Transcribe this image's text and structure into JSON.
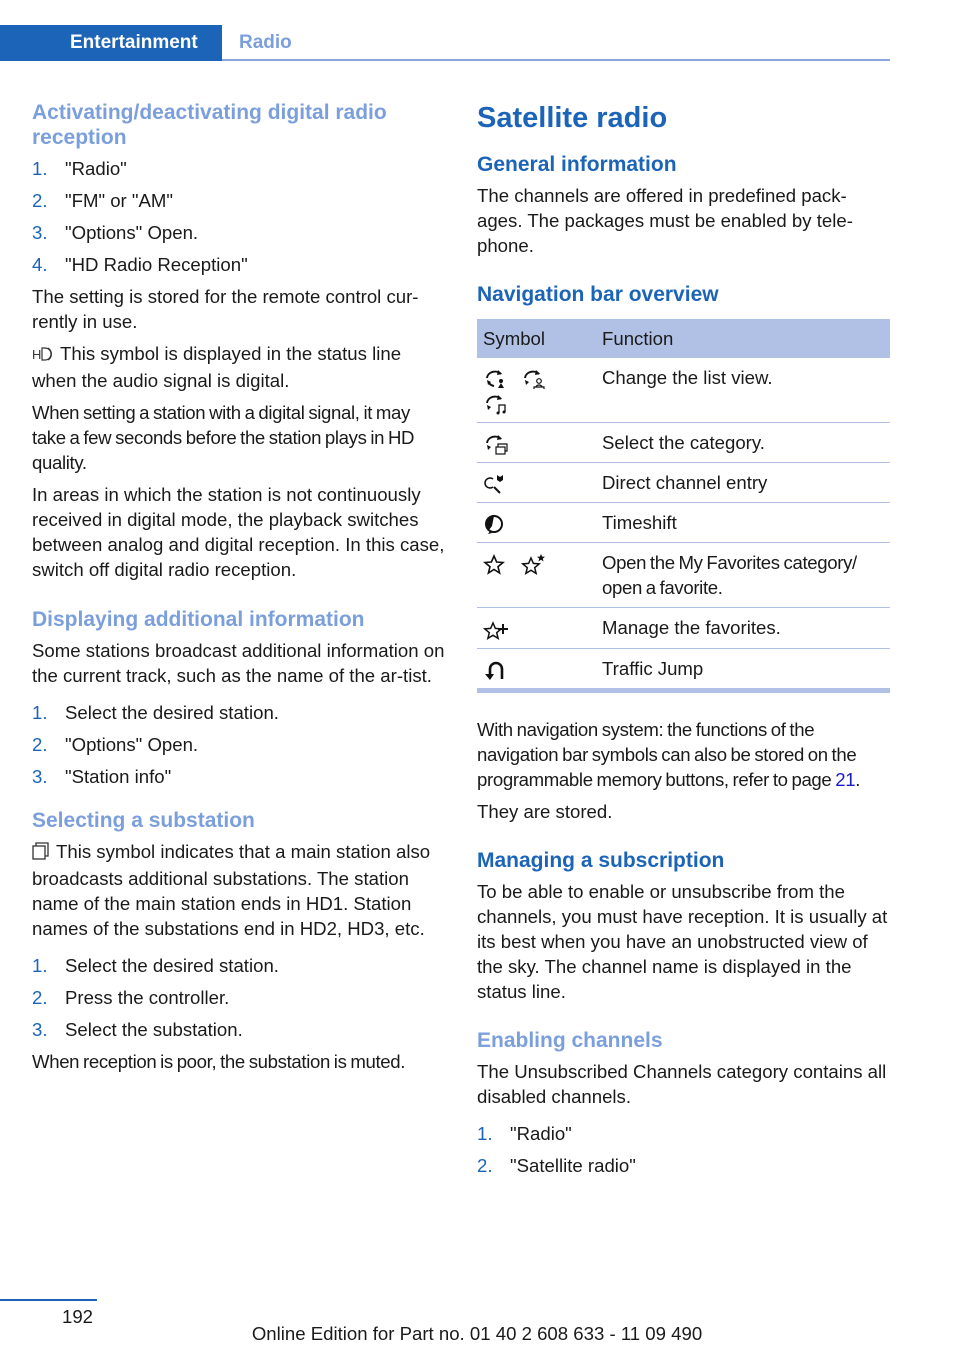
{
  "header": {
    "section": "Entertainment",
    "subsection": "Radio"
  },
  "left": {
    "activating": {
      "heading": "Activating/deactivating digital radio reception",
      "steps": [
        {
          "n": "1.",
          "text": "\"Radio\""
        },
        {
          "n": "2.",
          "text": "\"FM\" or \"AM\""
        },
        {
          "n": "3.",
          "text": "\"Options\" Open."
        },
        {
          "n": "4.",
          "text": "\"HD Radio Reception\""
        }
      ],
      "p1": "The setting is stored for the remote control cur-rently in use.",
      "hd_symbol_note": "This symbol is displayed in the status line when the audio signal is digital.",
      "p2": "When setting a station with a digital signal, it may take a few seconds before the station plays in HD quality.",
      "p3": "In areas in which the station is not continuously received in digital mode, the playback switches between analog and digital reception. In this case, switch off digital radio reception."
    },
    "additional": {
      "heading": "Displaying additional information",
      "p1": "Some stations broadcast additional information on the current track, such as the name of the ar-tist.",
      "steps": [
        {
          "n": "1.",
          "text": "Select the desired station."
        },
        {
          "n": "2.",
          "text": "\"Options\" Open."
        },
        {
          "n": "3.",
          "text": "\"Station info\""
        }
      ]
    },
    "substation": {
      "heading": "Selecting a substation",
      "symbol_note": "This symbol indicates that a main station also broadcasts additional substations. The station name of the main station ends in HD1. Station names of the substations end in HD2, HD3, etc.",
      "steps": [
        {
          "n": "1.",
          "text": "Select the desired station."
        },
        {
          "n": "2.",
          "text": "Press the controller."
        },
        {
          "n": "3.",
          "text": "Select the substation."
        }
      ],
      "p_end": "When reception is poor, the substation is muted."
    }
  },
  "right": {
    "title": "Satellite radio",
    "general": {
      "heading": "General information",
      "p1": "The channels are offered in predefined pack-ages. The packages must be enabled by tele-phone."
    },
    "navbar": {
      "heading": "Navigation bar overview",
      "col_symbol": "Symbol",
      "col_function": "Function",
      "rows": [
        {
          "icons": [
            "list-view-artist-icon",
            "list-view-person-icon",
            "list-view-music-icon"
          ],
          "function": "Change the list view."
        },
        {
          "icons": [
            "select-category-icon"
          ],
          "function": "Select the category."
        },
        {
          "icons": [
            "direct-channel-entry-icon"
          ],
          "function": "Direct channel entry"
        },
        {
          "icons": [
            "timeshift-icon"
          ],
          "function": "Timeshift"
        },
        {
          "icons": [
            "favorites-star-icon",
            "favorite-star-filled-icon"
          ],
          "function": "Open the My Favorites category/ open a favorite."
        },
        {
          "icons": [
            "manage-favorites-icon"
          ],
          "function": "Manage the favorites."
        },
        {
          "icons": [
            "traffic-jump-icon"
          ],
          "function": "Traffic Jump"
        }
      ],
      "p1_before": "With navigation system: the functions of the navigation bar symbols can also be stored on the programmable memory buttons, refer to page ",
      "p1_link": "21",
      "p1_after": ".",
      "p2": "They are stored."
    },
    "subscription": {
      "heading": "Managing a subscription",
      "p1": "To be able to enable or unsubscribe from the channels, you must have reception. It is usually at its best when you have an unobstructed view of the sky. The channel name is displayed in the status line."
    },
    "enabling": {
      "heading": "Enabling channels",
      "p1": "The Unsubscribed Channels category contains all disabled channels.",
      "steps": [
        {
          "n": "1.",
          "text": "\"Radio\""
        },
        {
          "n": "2.",
          "text": "\"Satellite radio\""
        }
      ]
    }
  },
  "footer": {
    "page": "192",
    "edition": "Online Edition for Part no. 01 40 2 608 633 - 11 09 490"
  },
  "colors": {
    "brand_blue": "#1c64b8",
    "light_blue": "#7b9fdc",
    "table_header": "#b1c1e6",
    "link": "#1a1acc"
  }
}
